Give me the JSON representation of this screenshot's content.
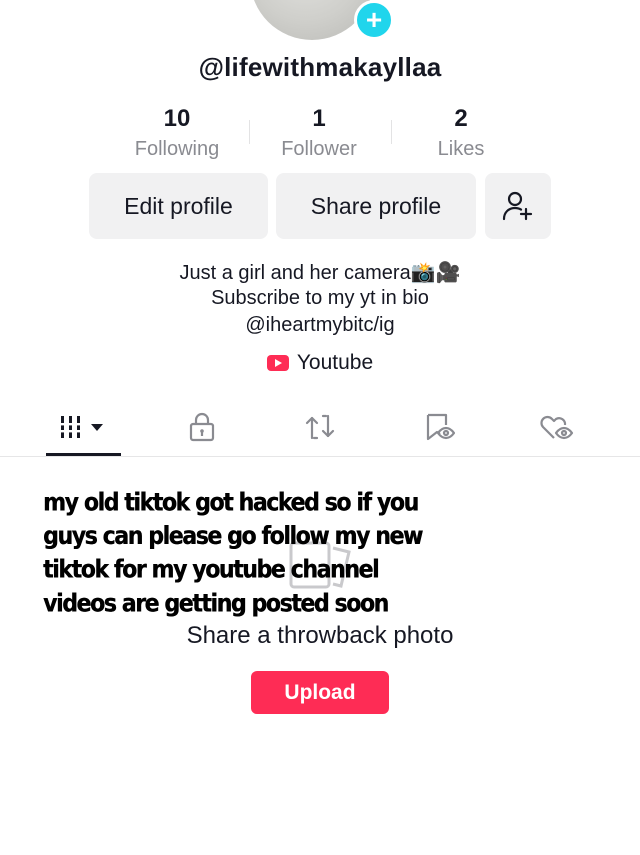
{
  "profile": {
    "username": "@lifewithmakayllaa",
    "stats": [
      {
        "value": "10",
        "label": "Following"
      },
      {
        "value": "1",
        "label": "Follower"
      },
      {
        "value": "2",
        "label": "Likes"
      }
    ],
    "buttons": {
      "edit": "Edit profile",
      "share": "Share profile",
      "add_friends_icon": "person-plus-icon"
    },
    "bio_lines": [
      "Just a girl and her camera📸🎥",
      "Subscribe to my yt in bio",
      "@iheartmybitc/ig"
    ],
    "link": {
      "icon": "youtube-icon",
      "label": "Youtube"
    }
  },
  "tabs": [
    {
      "name": "videos-grid",
      "icon": "grid-bars-icon",
      "active": true
    },
    {
      "name": "private",
      "icon": "lock-icon",
      "active": false
    },
    {
      "name": "reposts",
      "icon": "repost-icon",
      "active": false
    },
    {
      "name": "favorites",
      "icon": "bookmark-hidden-icon",
      "active": false
    },
    {
      "name": "liked",
      "icon": "heart-hidden-icon",
      "active": false
    }
  ],
  "content": {
    "overlay_text": "my old tiktok got hacked so if you guys can please go follow my new tiktok for my youtube channel videos are getting posted soon",
    "empty_title": "Share a throwback photo",
    "upload_label": "Upload"
  },
  "colors": {
    "accent": "#fe2c55",
    "avatar_add": "#20d5ec",
    "button_bg": "#f1f1f2",
    "muted_text": "#8a8b91"
  }
}
